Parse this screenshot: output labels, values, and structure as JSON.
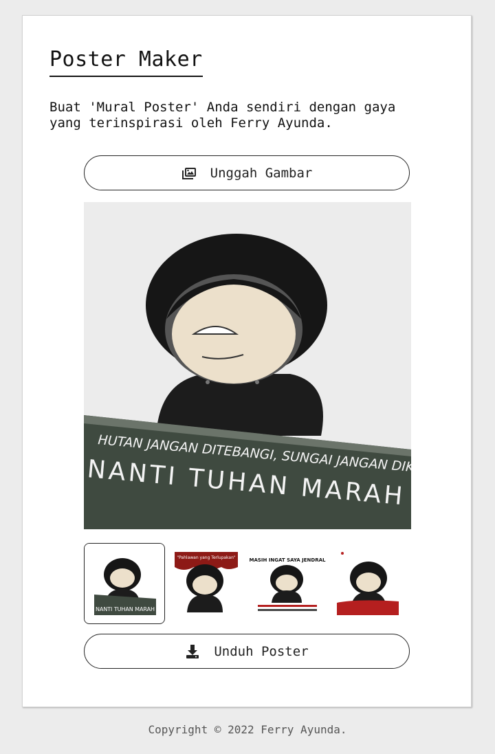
{
  "app": {
    "title": "Poster Maker",
    "description": "Buat 'Mural Poster' Anda sendiri dengan gaya yang terinspirasi oleh Ferry Ayunda."
  },
  "upload_button": {
    "label": "Unggah Gambar",
    "icon": "images-icon"
  },
  "preview": {
    "sign_line1": "HUTAN JANGAN DITEBANGI, SUNGAI JANGAN DIKOTORI",
    "sign_line2": "NANTI TUHAN MARAH"
  },
  "templates": [
    {
      "id": "t1",
      "selected": true,
      "top_text": "",
      "bottom_text": "NANTI TUHAN MARAH"
    },
    {
      "id": "t2",
      "selected": false,
      "top_text": "\"Pahlawan yang Terlupakan\"",
      "bottom_text": ""
    },
    {
      "id": "t3",
      "selected": false,
      "top_text": "MASIH INGAT SAYA JENDRAL",
      "bottom_text": ""
    },
    {
      "id": "t4",
      "selected": false,
      "top_text": "",
      "bottom_text": ""
    }
  ],
  "download_button": {
    "label": "Unduh Poster",
    "icon": "download-icon"
  },
  "footer": {
    "text": "Copyright © 2022 Ferry Ayunda."
  },
  "colors": {
    "background": "#ececec",
    "card": "#ffffff",
    "hood": "#1a1a1a",
    "sign": "#3f4a40",
    "accent_red": "#b51f1f"
  }
}
